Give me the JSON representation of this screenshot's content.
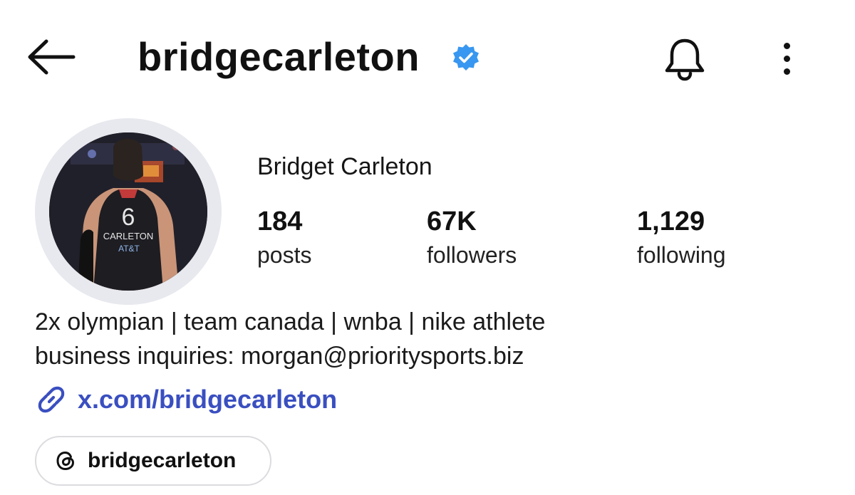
{
  "header": {
    "username": "bridgecarleton",
    "verified": true,
    "icons": {
      "back": "arrow-left-icon",
      "verified": "verified-badge-icon",
      "notifications": "bell-icon",
      "more": "more-vertical-icon"
    }
  },
  "profile": {
    "full_name": "Bridget Carleton",
    "avatar_jersey_number": "6",
    "avatar_jersey_name": "CARLETON",
    "avatar_sponsor": "AT&T",
    "stats": [
      {
        "value": "184",
        "label": "posts"
      },
      {
        "value": "67K",
        "label": "followers"
      },
      {
        "value": "1,129",
        "label": "following"
      }
    ]
  },
  "bio": {
    "line1": "2x olympian | team canada | wnba | nike athlete",
    "line2": "business inquiries: morgan@prioritysports.biz",
    "link_text": "x.com/bridgecarleton",
    "link_icon": "link-icon"
  },
  "threads": {
    "label": "bridgecarleton",
    "icon": "threads-icon"
  },
  "colors": {
    "verified_blue": "#3897f0",
    "link_color": "#3a4fc0",
    "ring": "#e8e9ee"
  }
}
